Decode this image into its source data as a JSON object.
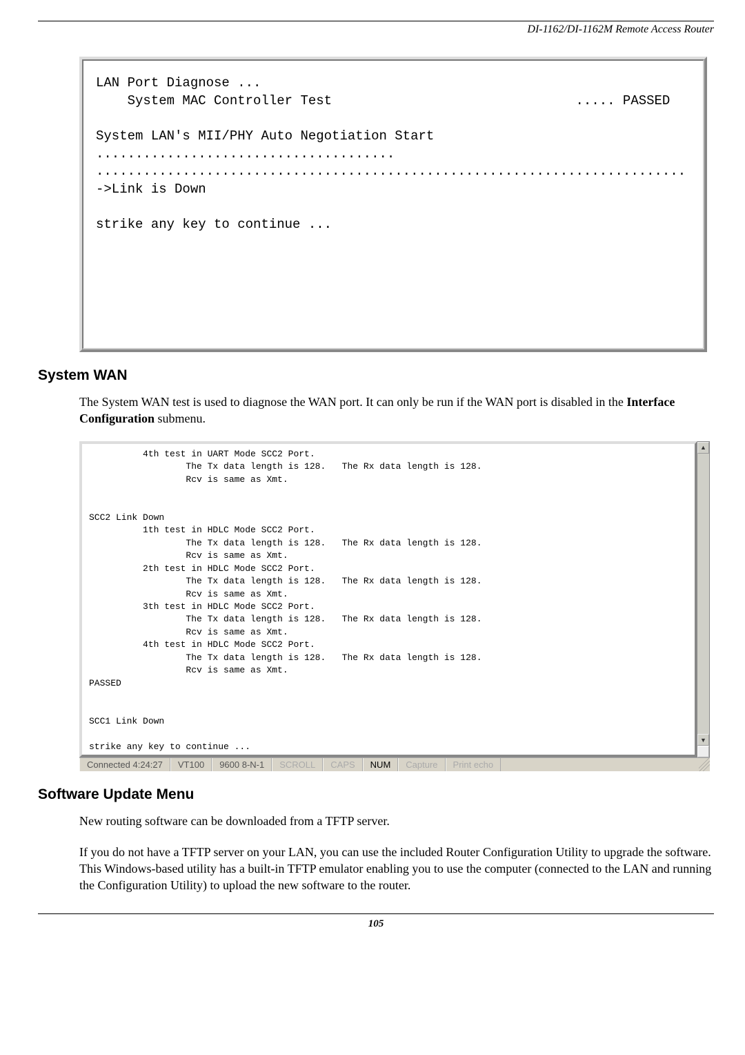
{
  "header": {
    "product": "DI-1162/DI-1162M Remote Access Router"
  },
  "terminal1": {
    "content": "LAN Port Diagnose ...\n    System MAC Controller Test                               ..... PASSED\n\nSystem LAN's MII/PHY Auto Negotiation Start ......................................\n...........................................................................\n->Link is Down\n\nstrike any key to continue ..."
  },
  "section_wan": {
    "heading": "System WAN",
    "para_prefix": "The System WAN test is used to diagnose the WAN port. It can only be run if the WAN port is disabled in the ",
    "para_bold": "Interface Configuration",
    "para_suffix": " submenu."
  },
  "terminal2": {
    "content": "          4th test in UART Mode SCC2 Port.\n                  The Tx data length is 128.   The Rx data length is 128.\n                  Rcv is same as Xmt.\n\n\nSCC2 Link Down\n          1th test in HDLC Mode SCC2 Port.\n                  The Tx data length is 128.   The Rx data length is 128.\n                  Rcv is same as Xmt.\n          2th test in HDLC Mode SCC2 Port.\n                  The Tx data length is 128.   The Rx data length is 128.\n                  Rcv is same as Xmt.\n          3th test in HDLC Mode SCC2 Port.\n                  The Tx data length is 128.   The Rx data length is 128.\n                  Rcv is same as Xmt.\n          4th test in HDLC Mode SCC2 Port.\n                  The Tx data length is 128.   The Rx data length is 128.\n                  Rcv is same as Xmt.\nPASSED\n\n\nSCC1 Link Down\n\nstrike any key to continue ..."
  },
  "statusbar": {
    "connected": "Connected 4:24:27",
    "emulation": "VT100",
    "port": "9600 8-N-1",
    "scroll": "SCROLL",
    "caps": "CAPS",
    "num": "NUM",
    "capture": "Capture",
    "printecho": "Print echo"
  },
  "section_update": {
    "heading": "Software Update Menu",
    "para1": "New routing software can be downloaded from a TFTP server.",
    "para2": "If you do not have a TFTP server on your LAN, you can use the included Router Configuration Utility to upgrade the software. This Windows-based utility has a built-in TFTP emulator enabling you to use the computer (connected to the LAN and running the Configuration Utility) to upload the new software to the router."
  },
  "page_number": "105",
  "chart_data": {
    "type": "table",
    "tests": [
      {
        "link": "SCC2 (UART)",
        "test_num": 4,
        "tx_length": 128,
        "rx_length": 128,
        "rcv_same_xmt": true
      },
      {
        "link": "SCC2 (HDLC)",
        "test_num": 1,
        "tx_length": 128,
        "rx_length": 128,
        "rcv_same_xmt": true
      },
      {
        "link": "SCC2 (HDLC)",
        "test_num": 2,
        "tx_length": 128,
        "rx_length": 128,
        "rcv_same_xmt": true
      },
      {
        "link": "SCC2 (HDLC)",
        "test_num": 3,
        "tx_length": 128,
        "rx_length": 128,
        "rcv_same_xmt": true
      },
      {
        "link": "SCC2 (HDLC)",
        "test_num": 4,
        "tx_length": 128,
        "rx_length": 128,
        "rcv_same_xmt": true
      }
    ],
    "result": "PASSED",
    "scc1_link": "Down",
    "scc2_link": "Down"
  }
}
